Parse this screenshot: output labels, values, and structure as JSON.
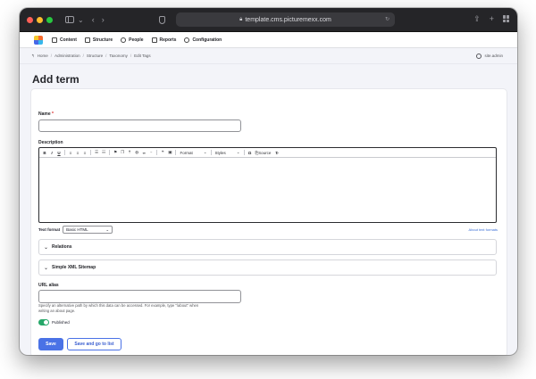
{
  "browser": {
    "url": "template.cms.picturemexx.com"
  },
  "toolbar": {
    "items": [
      {
        "label": "Content",
        "icon": "document-icon"
      },
      {
        "label": "Structure",
        "icon": "structure-icon"
      },
      {
        "label": "People",
        "icon": "person-icon"
      },
      {
        "label": "Reports",
        "icon": "chart-icon"
      },
      {
        "label": "Configuration",
        "icon": "wrench-icon"
      }
    ]
  },
  "breadcrumb": {
    "items": [
      "Home",
      "Administration",
      "Structure",
      "Taxonomy",
      "Edit Tags"
    ],
    "user": "site.admin"
  },
  "page": {
    "title": "Add term"
  },
  "form": {
    "name_label": "Name",
    "required_mark": "*",
    "name_value": "",
    "description_label": "Description",
    "editor_format": "Format",
    "editor_styles": "Styles",
    "editor_source": "Source",
    "text_format_label": "Text format",
    "text_format_value": "Basic HTML",
    "about_link": "About text formats",
    "relations": "Relations",
    "sitemap": "Simple XML Sitemap",
    "url_alias_label": "URL alias",
    "url_alias_value": "",
    "url_alias_help": "Specify an alternative path by which this data can be accessed. For example, type \"/about\" when writing an about page.",
    "published_label": "Published",
    "published": true,
    "save_label": "Save",
    "save_go_label": "Save and go to list"
  },
  "colors": {
    "primary": "#4a72e6",
    "toggle_on": "#26a769",
    "browser_chrome": "#252528"
  }
}
